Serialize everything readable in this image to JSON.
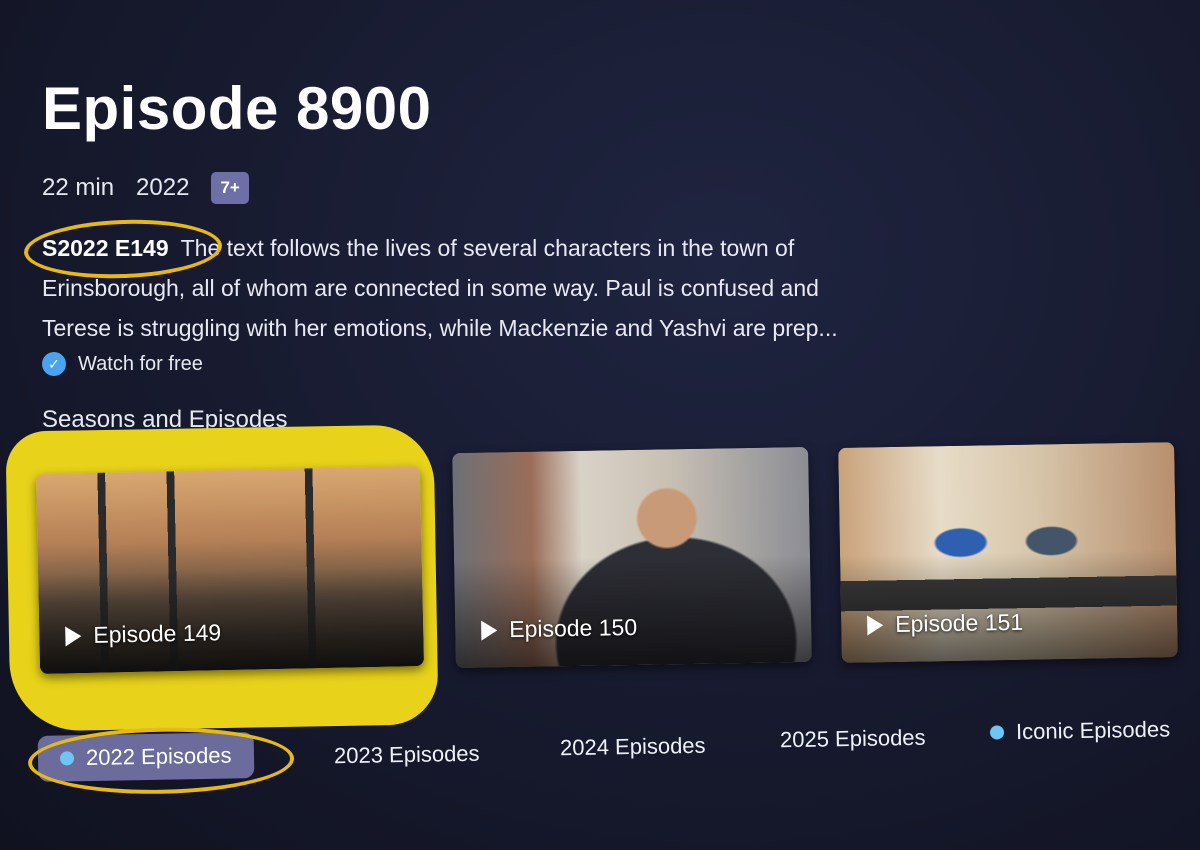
{
  "episode": {
    "title": "Episode 8900",
    "duration": "22 min",
    "year": "2022",
    "rating": "7+",
    "code": "S2022 E149",
    "synopsis": "The text follows the lives of several characters in the town of Erinsborough, all of whom are connected in some way. Paul is confused and Terese is struggling with her emotions, while Mackenzie and Yashvi are prep...",
    "availability": "Watch for free"
  },
  "episodes_section": {
    "heading": "Seasons and Episodes",
    "cards": [
      {
        "label": "Episode 149",
        "selected": true
      },
      {
        "label": "Episode 150",
        "selected": false
      },
      {
        "label": "Episode 151",
        "selected": false
      }
    ]
  },
  "tabs": [
    {
      "label": "2022 Episodes",
      "selected": true
    },
    {
      "label": "2023 Episodes",
      "selected": false
    },
    {
      "label": "2024 Episodes",
      "selected": false
    },
    {
      "label": "2025 Episodes",
      "selected": false
    },
    {
      "label": "Iconic Episodes",
      "selected": false
    }
  ],
  "colors": {
    "background": "#171a2e",
    "accent_check": "#4aa3f0",
    "rating_badge": "#6f6fa8",
    "selected_tab": "#6b6c9c",
    "highlight_annotation": "#e8d31a",
    "circle_annotation": "#e6b818"
  },
  "icons": {
    "availability": "check-circle-icon",
    "card": "play-icon",
    "tab_marker": "dot-icon"
  }
}
